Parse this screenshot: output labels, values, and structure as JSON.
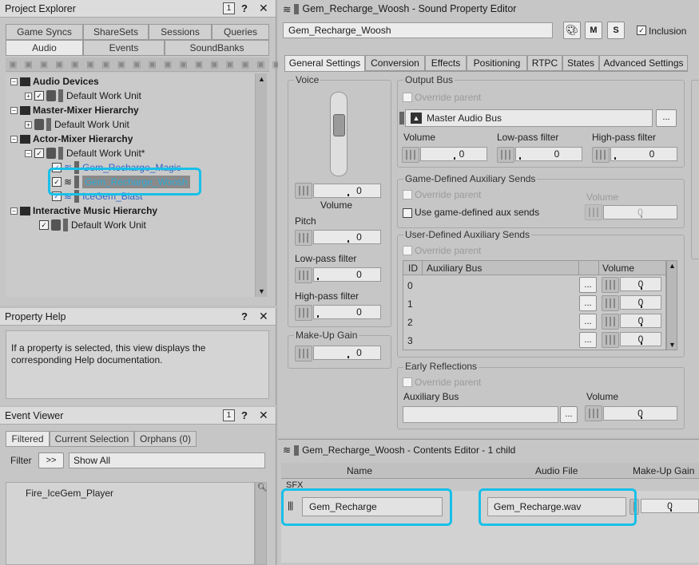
{
  "project_explorer": {
    "title": "Project Explorer",
    "tabs_top": [
      "Game Syncs",
      "ShareSets",
      "Sessions",
      "Queries"
    ],
    "tabs_bottom": [
      "Audio",
      "Events",
      "SoundBanks"
    ],
    "tree": [
      {
        "label": "Audio Devices",
        "bold": true
      },
      {
        "label": "Default Work Unit"
      },
      {
        "label": "Master-Mixer Hierarchy",
        "bold": true
      },
      {
        "label": "Default Work Unit"
      },
      {
        "label": "Actor-Mixer Hierarchy",
        "bold": true
      },
      {
        "label": "Default Work Unit*"
      },
      {
        "label": "Gem_Recharge_Magic"
      },
      {
        "label": "Gem_Recharge_Woosh"
      },
      {
        "label": "IceGem_Blast"
      },
      {
        "label": "Interactive Music Hierarchy",
        "bold": true
      },
      {
        "label": "Default Work Unit"
      }
    ]
  },
  "property_help": {
    "title": "Property Help",
    "text": "If a property is selected, this view displays the corresponding Help documentation."
  },
  "event_viewer": {
    "title": "Event Viewer",
    "tabs": [
      "Filtered",
      "Current Selection",
      "Orphans (0)"
    ],
    "filter_label": "Filter",
    "filter_btn": ">>",
    "filter_value": "Show All",
    "items": [
      "Fire_IceGem_Player"
    ]
  },
  "editor": {
    "title": "Gem_Recharge_Woosh - Sound Property Editor",
    "name_value": "Gem_Recharge_Woosh",
    "m_label": "M",
    "s_label": "S",
    "inclusion_label": "Inclusion",
    "tabs": [
      "General Settings",
      "Conversion",
      "Effects",
      "Positioning",
      "RTPC",
      "States",
      "Advanced Settings"
    ]
  },
  "voice": {
    "title": "Voice",
    "volume_value": "0",
    "volume_label": "Volume",
    "pitch_label": "Pitch",
    "pitch_value": "0",
    "lpf_label": "Low-pass filter",
    "lpf_value": "0",
    "hpf_label": "High-pass filter",
    "hpf_value": "0"
  },
  "makeup": {
    "title": "Make-Up Gain",
    "value": "0"
  },
  "output_bus": {
    "title": "Output Bus",
    "override": "Override parent",
    "bus": "Master Audio Bus",
    "browse": "...",
    "volume_label": "Volume",
    "volume_value": "0",
    "lpf_label": "Low-pass filter",
    "lpf_value": "0",
    "hpf_label": "High-pass filter",
    "hpf_value": "0"
  },
  "game_aux": {
    "title": "Game-Defined Auxiliary Sends",
    "override": "Override parent",
    "use_label": "Use game-defined aux sends",
    "volume_label": "Volume",
    "volume_value": "0"
  },
  "user_aux": {
    "title": "User-Defined Auxiliary Sends",
    "override": "Override parent",
    "col_id": "ID",
    "col_bus": "Auxiliary Bus",
    "col_volume": "Volume",
    "rows": [
      {
        "id": "0",
        "value": "0"
      },
      {
        "id": "1",
        "value": "0"
      },
      {
        "id": "2",
        "value": "0"
      },
      {
        "id": "3",
        "value": "0"
      }
    ],
    "browse": "..."
  },
  "early": {
    "title": "Early Reflections",
    "override": "Override parent",
    "bus_label": "Auxiliary Bus",
    "volume_label": "Volume",
    "volume_value": "0",
    "browse": "..."
  },
  "contents": {
    "title": "Gem_Recharge_Woosh - Contents Editor - 1 child",
    "col_name": "Name",
    "col_file": "Audio File",
    "col_gain": "Make-Up Gain",
    "group": "SFX",
    "item_name": "Gem_Recharge",
    "item_file": "Gem_Recharge.wav",
    "gain": "0"
  }
}
